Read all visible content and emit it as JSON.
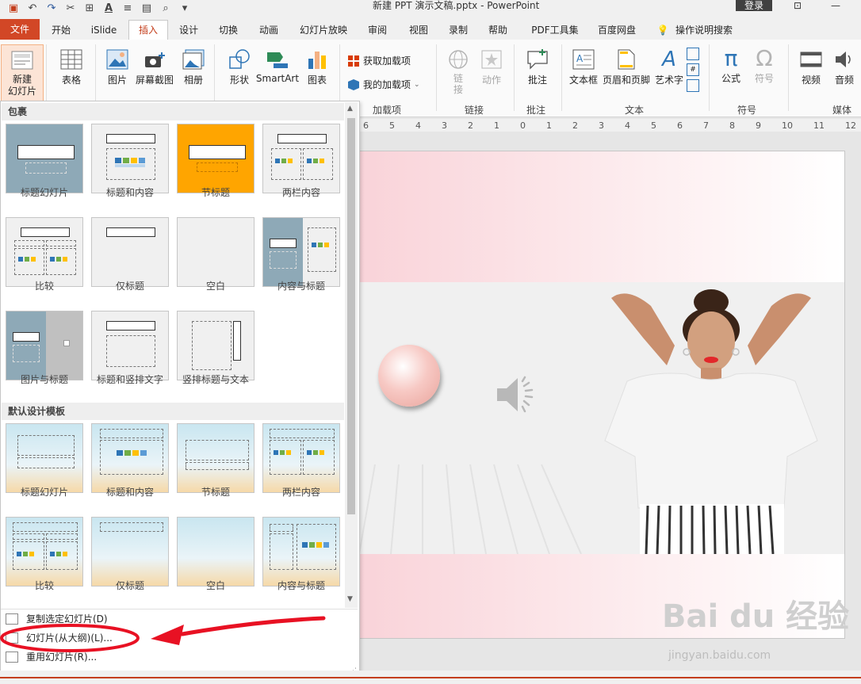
{
  "window": {
    "title": "新建 PPT 演示文稿.pptx  -  PowerPoint",
    "login_label": "登录"
  },
  "menu": {
    "file": "文件",
    "tabs": [
      "开始",
      "iSlide",
      "插入",
      "设计",
      "切换",
      "动画",
      "幻灯片放映",
      "审阅",
      "视图",
      "录制",
      "帮助",
      "PDF工具集",
      "百度网盘"
    ],
    "active_tab": "插入",
    "search": "操作说明搜索"
  },
  "ribbon": {
    "new_slide": "新建\n幻灯片",
    "table": "表格",
    "picture": "图片",
    "screenshot": "屏幕截图",
    "album": "相册",
    "shapes": "形状",
    "smartart": "SmartArt",
    "chart": "图表",
    "get_addins": "获取加载项",
    "my_addins": "我的加载项",
    "group_addins": "加载项",
    "link": "链\n接",
    "action": "动作",
    "group_links": "链接",
    "comment": "批注",
    "group_comments": "批注",
    "textbox": "文本框",
    "header_footer": "页眉和页脚",
    "wordart": "艺术字",
    "group_text": "文本",
    "equation": "公式",
    "symbol": "符号",
    "group_symbols": "符号",
    "video": "视频",
    "audio": "音频",
    "group_media": "媒体"
  },
  "gallery": {
    "section1": "包裹",
    "section2": "默认设计模板",
    "layouts1": [
      "标题幻灯片",
      "标题和内容",
      "节标题",
      "两栏内容",
      "比较",
      "仅标题",
      "空白",
      "内容与标题",
      "图片与标题",
      "标题和竖排文字",
      "竖排标题与文本"
    ],
    "layouts2": [
      "标题幻灯片",
      "标题和内容",
      "节标题",
      "两栏内容",
      "比较",
      "仅标题",
      "空白",
      "内容与标题"
    ],
    "menu_items": [
      "复制选定幻灯片(D)",
      "幻灯片(从大纲)(L)...",
      "重用幻灯片(R)..."
    ]
  },
  "ruler": {
    "labels": [
      "6",
      "5",
      "4",
      "3",
      "2",
      "1",
      "0",
      "1",
      "2",
      "3",
      "4",
      "5",
      "6",
      "7",
      "8",
      "9",
      "10",
      "11",
      "12"
    ]
  },
  "watermark": {
    "text": "Bai du 经验",
    "url": "jingyan.baidu.com"
  },
  "colors": {
    "accent": "#c43e1c",
    "file_tab": "#d24726",
    "highlight": "#e81123",
    "section_orange": "#ffa500",
    "layout_blue": "#8ea9b7"
  }
}
